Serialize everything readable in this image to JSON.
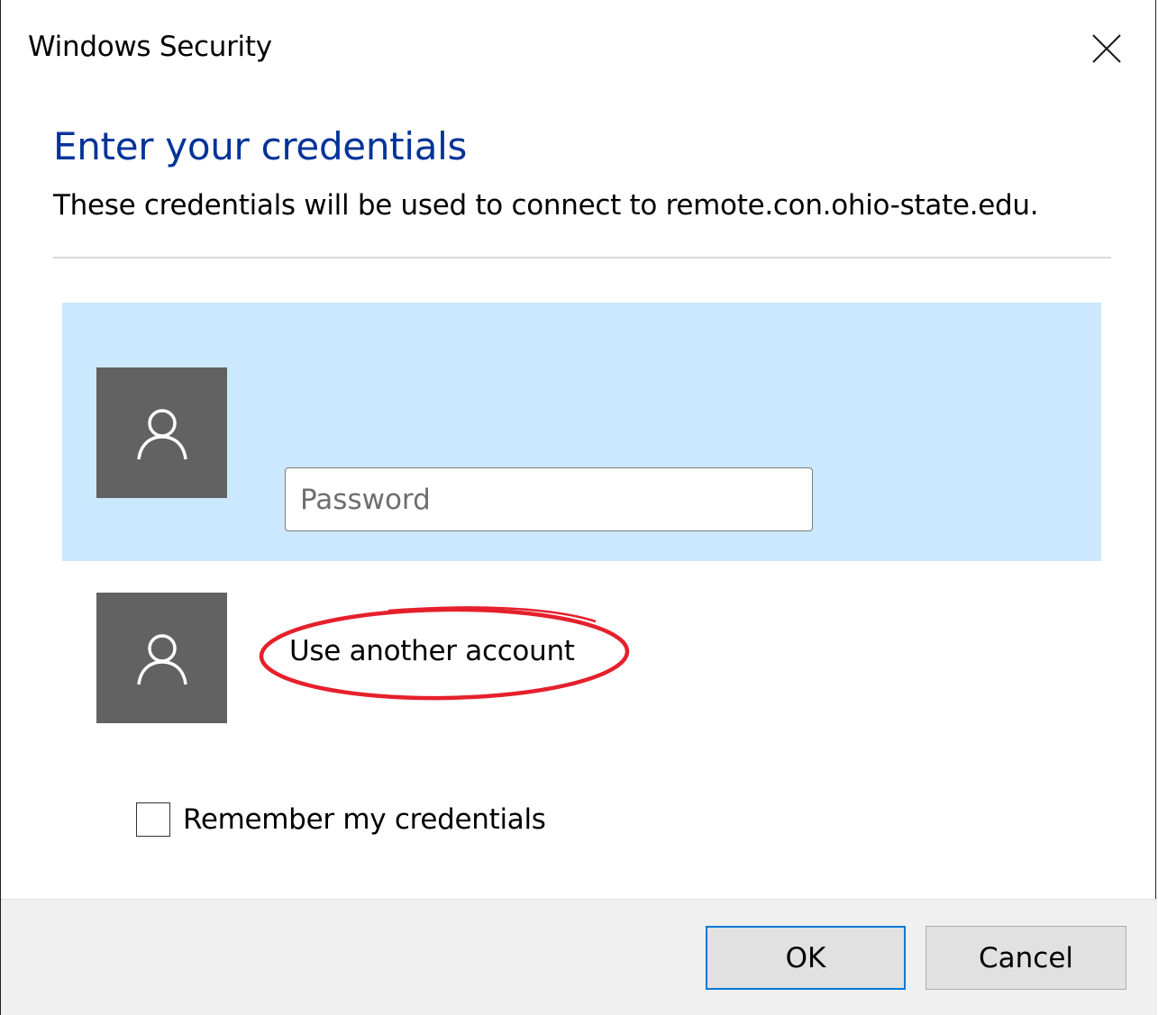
{
  "window": {
    "title": "Windows Security"
  },
  "dialog": {
    "heading": "Enter your credentials",
    "subtext": "These credentials will be used to connect to remote.con.ohio-state.edu."
  },
  "accounts": {
    "selected": {
      "password_placeholder": "Password",
      "password_value": ""
    },
    "another_label": "Use another account"
  },
  "options": {
    "remember_label": "Remember my credentials",
    "remember_checked": false
  },
  "buttons": {
    "ok_label": "OK",
    "cancel_label": "Cancel"
  },
  "colors": {
    "heading": "#003399",
    "selection_bg": "#cce8ff",
    "avatar_bg": "#626262",
    "annotation": "#e5202c",
    "ok_border": "#0078d7"
  },
  "icons": {
    "close": "close-icon",
    "avatar": "user-icon"
  }
}
